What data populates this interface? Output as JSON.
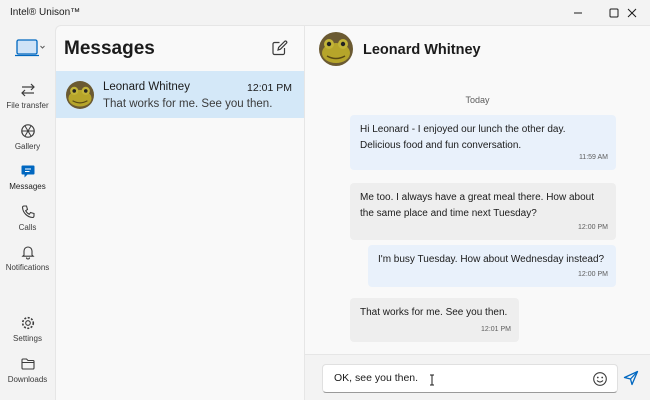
{
  "window": {
    "title": "Intel® Unison™",
    "controls": [
      "minimize",
      "maximize",
      "close"
    ]
  },
  "nav": {
    "items": [
      {
        "label": "File transfer",
        "icon": "file-transfer-icon"
      },
      {
        "label": "Gallery",
        "icon": "gallery-icon"
      },
      {
        "label": "Messages",
        "icon": "messages-icon",
        "active": true
      },
      {
        "label": "Calls",
        "icon": "phone-icon"
      },
      {
        "label": "Notifications",
        "icon": "bell-icon"
      }
    ],
    "bottom_items": [
      {
        "label": "Settings",
        "icon": "gear-icon"
      },
      {
        "label": "Downloads",
        "icon": "folder-icon"
      }
    ]
  },
  "messages_list": {
    "title": "Messages",
    "conversations": [
      {
        "name": "Leonard Whitney",
        "time": "12:01 PM",
        "preview": "That works for me. See you then.",
        "selected": true
      }
    ]
  },
  "chat": {
    "contact_name": "Leonard Whitney",
    "day_label": "Today",
    "messages": [
      {
        "from": "me",
        "lines": [
          "Hi Leonard - I enjoyed our lunch the other day.",
          "Delicious food and fun conversation."
        ],
        "time": "11:59 AM"
      },
      {
        "from": "them",
        "lines": [
          "Me too. I always have a great meal there. How about",
          "the same place and time next Tuesday?"
        ],
        "time": "12:00 PM"
      },
      {
        "from": "me",
        "lines": [
          "I'm busy Tuesday. How about Wednesday instead?"
        ],
        "time": "12:00 PM"
      },
      {
        "from": "them",
        "lines": [
          "That works for me. See you then."
        ],
        "time": "12:01 PM"
      }
    ],
    "composer": {
      "value": "OK, see you then."
    }
  },
  "colors": {
    "accent": "#0067c0",
    "selected_row": "#d4e8f8",
    "my_bubble": "#e9f1fb",
    "their_bubble": "#eeeeee"
  }
}
